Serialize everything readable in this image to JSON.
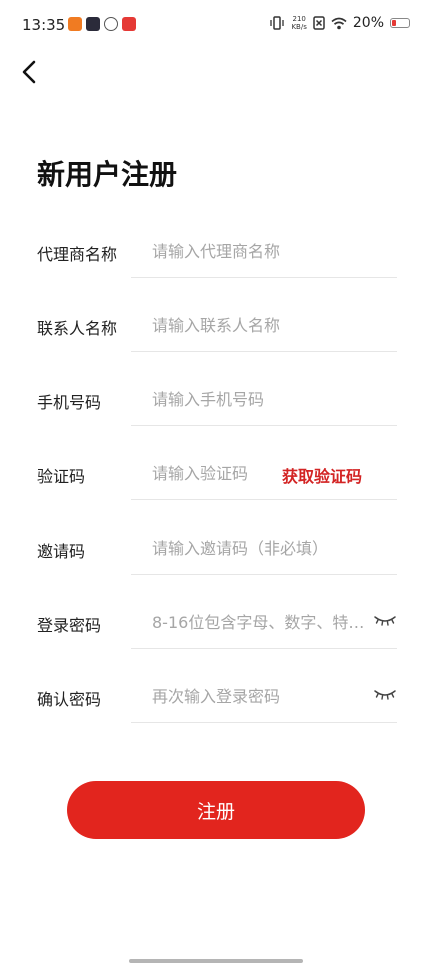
{
  "status_bar": {
    "time": "13:35",
    "net_speed_value": "210",
    "net_speed_unit": "KB/s",
    "battery_percent": "20%",
    "battery_level": 0.2,
    "notification_icons": [
      "app-badge-icon",
      "play-icon",
      "link-icon",
      "news-icon"
    ]
  },
  "header": {
    "back_icon": "chevron-left-icon"
  },
  "title": "新用户注册",
  "fields": {
    "agent_name": {
      "label": "代理商名称",
      "placeholder": "请输入代理商名称",
      "value": ""
    },
    "contact_name": {
      "label": "联系人名称",
      "placeholder": "请输入联系人名称",
      "value": ""
    },
    "phone": {
      "label": "手机号码",
      "placeholder": "请输入手机号码",
      "value": ""
    },
    "verify_code": {
      "label": "验证码",
      "placeholder": "请输入验证码",
      "value": "",
      "action": "获取验证码"
    },
    "invite_code": {
      "label": "邀请码",
      "placeholder": "请输入邀请码（非必填）",
      "value": ""
    },
    "password": {
      "label": "登录密码",
      "placeholder": "8-16位包含字母、数字、特…",
      "value": "",
      "toggle_icon": "eye-closed-icon"
    },
    "confirm_password": {
      "label": "确认密码",
      "placeholder": "再次输入登录密码",
      "value": "",
      "toggle_icon": "eye-closed-icon"
    }
  },
  "submit_label": "注册",
  "colors": {
    "accent": "#e2251e",
    "link": "#d32424",
    "placeholder": "#a6a6a6",
    "divider": "#e6e6e6"
  }
}
